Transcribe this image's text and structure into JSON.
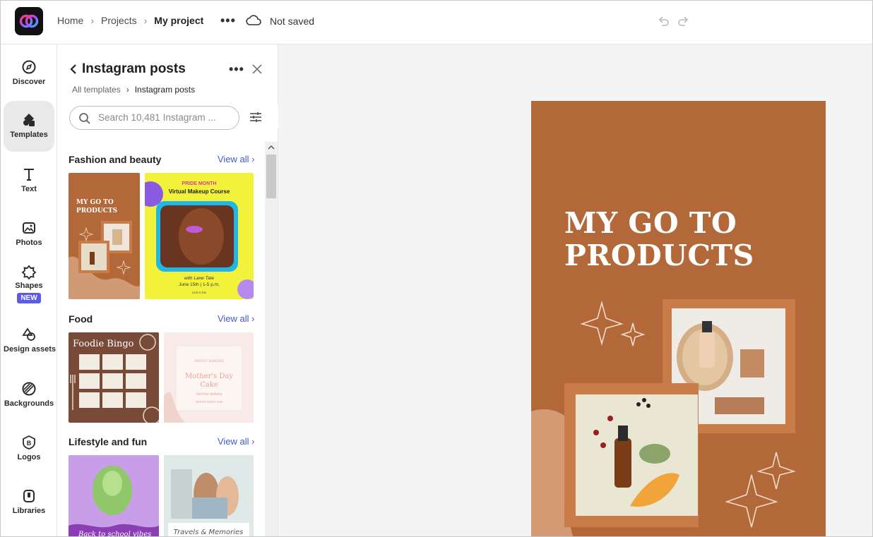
{
  "header": {
    "breadcrumbs": [
      "Home",
      "Projects"
    ],
    "current_project": "My project",
    "more_label": "•••",
    "save_status": "Not saved"
  },
  "rail": {
    "items": [
      {
        "label": "Discover",
        "icon": "compass-icon"
      },
      {
        "label": "Templates",
        "icon": "templates-icon",
        "active": true
      },
      {
        "label": "Text",
        "icon": "text-icon"
      },
      {
        "label": "Photos",
        "icon": "photo-icon"
      },
      {
        "label": "Shapes",
        "icon": "shapes-icon",
        "badge": "NEW"
      },
      {
        "label": "Design assets",
        "icon": "design-assets-icon"
      },
      {
        "label": "Backgrounds",
        "icon": "backgrounds-icon"
      },
      {
        "label": "Logos",
        "icon": "logo-icon"
      },
      {
        "label": "Libraries",
        "icon": "libraries-icon"
      }
    ]
  },
  "panel": {
    "title": "Instagram posts",
    "more_label": "•••",
    "crumb_root": "All templates",
    "crumb_current": "Instagram posts",
    "search_placeholder": "Search 10,481 Instagram ...",
    "sections": [
      {
        "title": "Fashion and beauty",
        "view_all": "View all"
      },
      {
        "title": "Food",
        "view_all": "View all"
      },
      {
        "title": "Lifestyle and fun",
        "view_all": "View all"
      }
    ],
    "thumbs": {
      "fashion_1": {
        "title_line1": "MY GO TO",
        "title_line2": "PRODUCTS"
      },
      "fashion_2": {
        "kicker": "PRIDE MONTH",
        "title": "Virtual Makeup Course",
        "host": "with Lane Tate",
        "date": "June 15th | 1-5 p.m.",
        "link": "Link in bio"
      },
      "food_1": {
        "title": "Foodie Bingo"
      },
      "food_2": {
        "kicker": "SWEET BAKERY",
        "title_line1": "Mother's Day",
        "title_line2": "Cake",
        "sub": "Get free delivery",
        "promo": "OFFER ENDS 4/30"
      },
      "life_1": {
        "caption": "Back to school vibes"
      },
      "life_2": {
        "caption": "Travels & Memories"
      }
    }
  },
  "artboard": {
    "title_line1": "MY GO TO",
    "title_line2": "PRODUCTS",
    "background": "#b26838"
  },
  "colors": {
    "accent": "#3f5bd6",
    "badge": "#5c5ce0",
    "artboard": "#b26838"
  }
}
